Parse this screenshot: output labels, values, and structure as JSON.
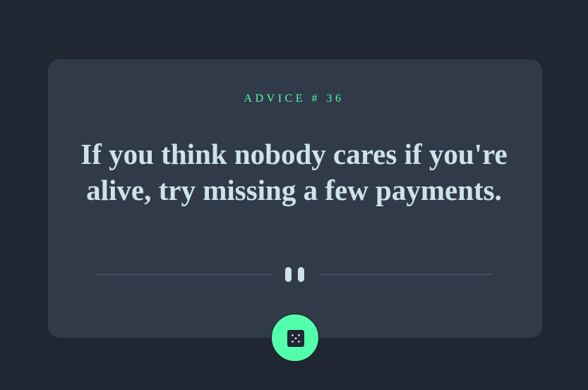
{
  "card": {
    "advice_label": "ADVICE",
    "advice_hash": "#",
    "advice_number": "36",
    "advice_text": "If you think nobody cares if you're alive, try missing a few payments."
  },
  "icons": {
    "divider": "pause-icon",
    "button": "dice-icon"
  },
  "colors": {
    "background": "#202632",
    "card": "#313a49",
    "accent": "#53ffaa",
    "text": "#cee3e9",
    "divider": "#4f5d74"
  }
}
